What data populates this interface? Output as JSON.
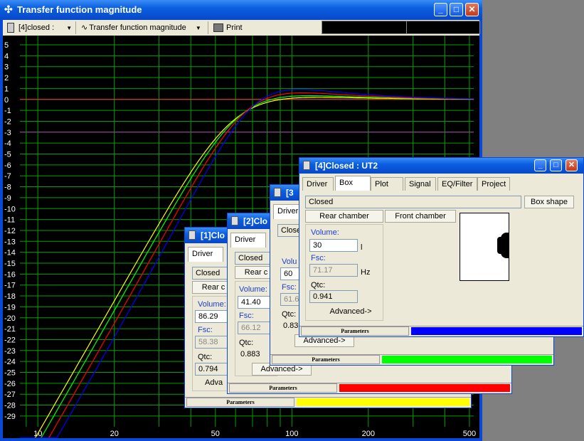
{
  "main_window": {
    "title": "Transfer function magnitude",
    "toolbar": {
      "enclosure_select": "[4]closed :",
      "function_select": "Transfer function magnitude",
      "print_label": "Print"
    }
  },
  "plot": {
    "y_ticks": [
      "5",
      "4",
      "3",
      "2",
      "1",
      "0",
      "-1",
      "-2",
      "-3",
      "-4",
      "-5",
      "-6",
      "-7",
      "-8",
      "-9",
      "-10",
      "-11",
      "-12",
      "-13",
      "-14",
      "-15",
      "-16",
      "-17",
      "-18",
      "-19",
      "-20",
      "-21",
      "-22",
      "-23",
      "-24",
      "-25",
      "-26",
      "-27",
      "-28",
      "-29"
    ],
    "x_ticks": [
      "10",
      "20",
      "50",
      "100",
      "200",
      "500"
    ],
    "colors": {
      "grid": "#00a000",
      "ref0": "#ff3030",
      "ref_minus3": "#b030b0",
      "yellow": "#ffff00",
      "green": "#00ff00",
      "red": "#ff0000",
      "blue": "#0000ff"
    }
  },
  "windows": [
    {
      "id": "w1",
      "title": "[1]Clo",
      "tabs": [
        "Driver"
      ],
      "box_type": "Closed",
      "rear_button": "Rear c",
      "volume_label": "Volume:",
      "volume_value": "86.29",
      "fsc_label": "Fsc:",
      "fsc_value": "58.38",
      "qtc_label": "Qtc:",
      "qtc_value": "0.794",
      "advanced": "Adva",
      "status_label": "Parameters",
      "status_color": "#ffff00"
    },
    {
      "id": "w2",
      "title": "[2]Clo",
      "tabs": [
        "Driver"
      ],
      "box_type": "Closed",
      "rear_button": "Rear c",
      "volume_label": "Volume:",
      "volume_value": "41.40",
      "fsc_label": "Fsc:",
      "fsc_value": "66.12",
      "qtc_label": "Qtc:",
      "qtc_value": "0.883",
      "advanced": "Advanced->",
      "status_label": "Parameters",
      "status_color": "#ff0000"
    },
    {
      "id": "w3",
      "title": "[3",
      "tabs": [
        "Driver"
      ],
      "box_type": "Close",
      "volume_label": "Volu",
      "volume_value": "60",
      "fsc_label": "Fsc:",
      "fsc_value": "61.6",
      "qtc_label": "Qtc:",
      "qtc_value": "0.83",
      "advanced": "Advanced->",
      "status_label": "Parameters",
      "status_color": "#00ff00"
    },
    {
      "id": "w4",
      "title": "[4]Closed : UT2",
      "tabs": [
        "Driver",
        "Box",
        "Plot",
        "Signal",
        "EQ/Filter",
        "Project"
      ],
      "active_tab": "Box",
      "box_type": "Closed",
      "box_shape_button": "Box shape",
      "rear_button": "Rear chamber",
      "front_button": "Front chamber",
      "volume_label": "Volume:",
      "volume_value": "30",
      "volume_unit": "l",
      "fsc_label": "Fsc:",
      "fsc_value": "71.17",
      "fsc_unit": "Hz",
      "qtc_label": "Qtc:",
      "qtc_value": "0.941",
      "advanced": "Advanced->",
      "status_label": "Parameters",
      "status_color": "#0000ff"
    }
  ]
}
